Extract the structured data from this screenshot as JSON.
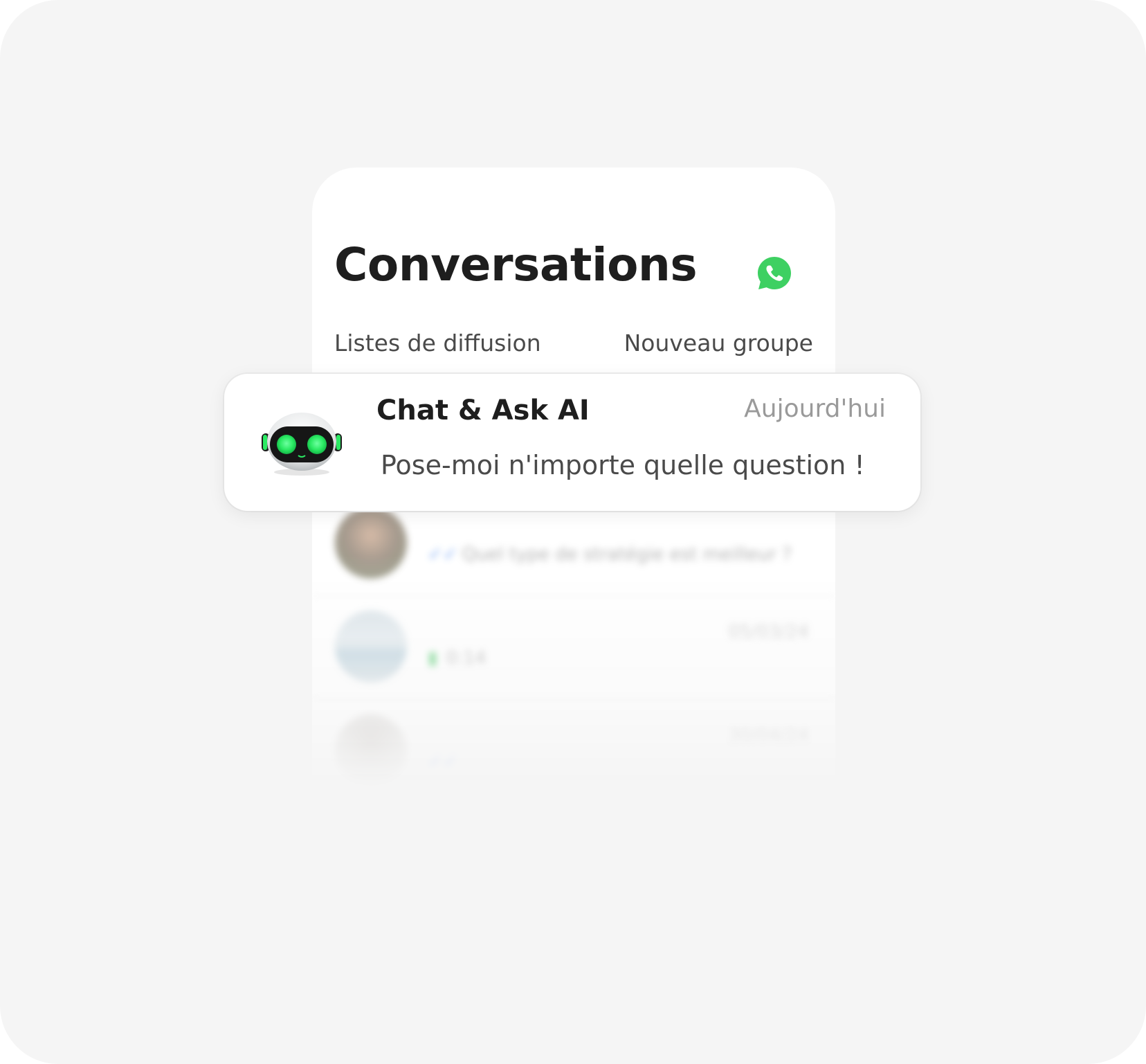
{
  "header": {
    "title": "Conversations",
    "app_icon": "whatsapp-icon"
  },
  "actions": {
    "broadcast_lists": "Listes de diffusion",
    "new_group": "Nouveau groupe"
  },
  "highlighted_chat": {
    "name": "Chat & Ask AI",
    "date": "Aujourd'hui",
    "preview": "Pose-moi n'importe quelle question !",
    "avatar_icon": "robot-icon"
  },
  "chats": [
    {
      "date": "",
      "preview": "Quel type de stratégie est meilleur ?",
      "status_icon": "double-check-icon"
    },
    {
      "date": "05/03/24",
      "preview": "0:14",
      "status_icon": "microphone-icon"
    },
    {
      "date": "30/04/24",
      "preview": "",
      "status_icon": "double-check-icon"
    }
  ],
  "colors": {
    "background": "#f5f5f5",
    "card": "#ffffff",
    "whatsapp_green": "#3ed062",
    "robot_eye_green": "#2bea63",
    "check_blue": "#4d8bf0"
  }
}
